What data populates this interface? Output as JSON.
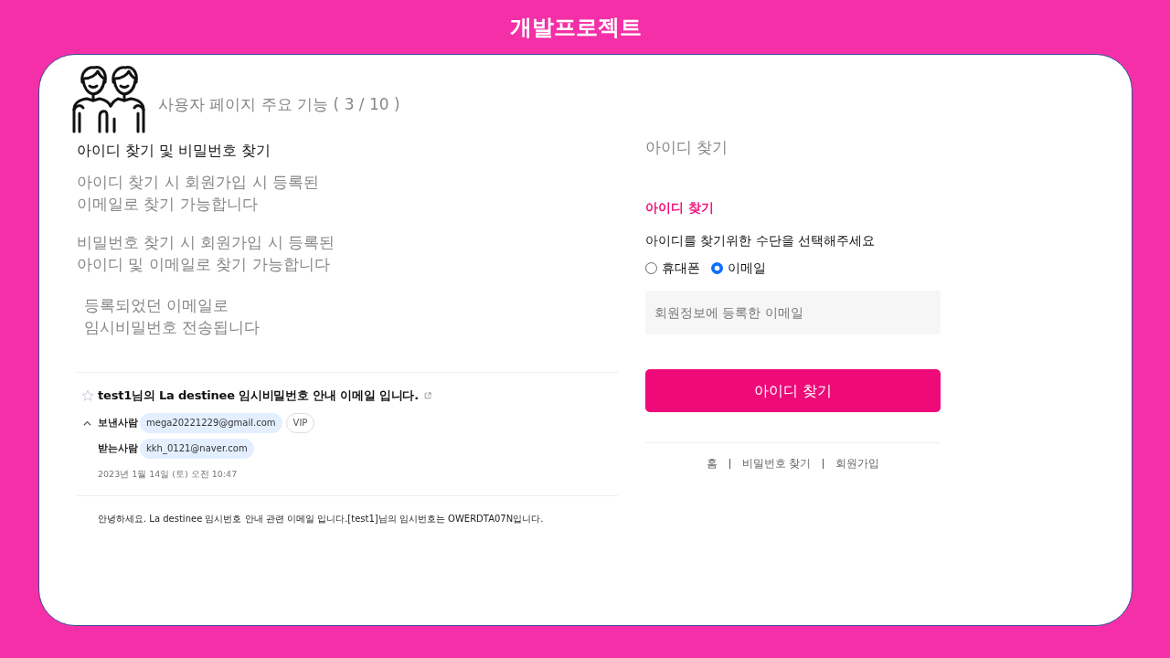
{
  "header": {
    "title": "개발프로젝트"
  },
  "intro": {
    "subtitle": "사용자 페이지 주요 기능 ( 3 / 10 )",
    "heading": "아이디 찾기 및 비밀번호 찾기",
    "paragraphs": [
      {
        "lines": [
          "아이디 찾기 시 회원가입 시 등록된",
          "이메일로 찾기 가능합니다"
        ],
        "indented": false
      },
      {
        "lines": [
          "비밀번호 찾기 시 회원가입 시 등록된",
          "아이디 및 이메일로 찾기 가능합니다"
        ],
        "indented": false
      },
      {
        "lines": [
          "등록되었던 이메일로",
          "임시비밀번호 전송됩니다"
        ],
        "indented": true
      }
    ]
  },
  "email_preview": {
    "starred": false,
    "subject": "test1님의 La destinee 임시비밀번호 안내 이메일 입니다.",
    "expanded": true,
    "sender_label": "보낸사람",
    "sender": "mega20221229@gmail.com",
    "sender_tag": "VIP",
    "recipient_label": "받는사람",
    "recipient": "kkh_0121@naver.com",
    "date": "2023년 1월 14일 (토) 오전 10:47",
    "body": "안녕하세요. La destinee 임시번호 안내 관련 이메일 입니다.[test1]님의 임시번호는 OWERDTA07N입니다."
  },
  "find_id": {
    "page_title": "아이디 찾기",
    "section_title": "아이디 찾기",
    "instruction": "아이디를 찾기위한 수단을 선택해주세요",
    "methods": [
      {
        "label": "휴대폰",
        "selected": false
      },
      {
        "label": "이메일",
        "selected": true
      }
    ],
    "email_field": {
      "placeholder": "회원정보에 등록한 이메일"
    },
    "submit": "아이디 찾기",
    "links": [
      "홈",
      "비밀번호 찾기",
      "회원가입"
    ]
  }
}
